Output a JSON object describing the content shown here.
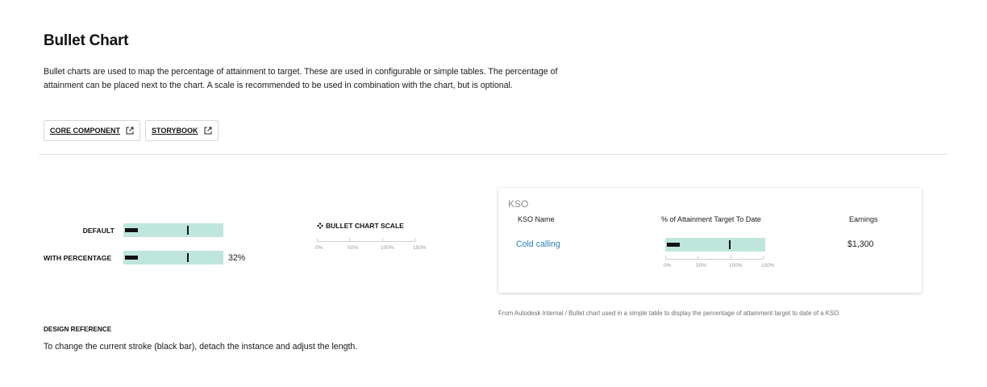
{
  "header": {
    "title": "Bullet Chart",
    "description": "Bullet charts are used to map the percentage of attainment to target. These are used in configurable or simple tables. The percentage of attainment can be placed next to the chart. A scale is recommended to be used in combination with the chart, but is optional."
  },
  "links": {
    "core_component": "CORE COMPONENT",
    "storybook": "STORYBOOK"
  },
  "demo": {
    "default_label": "DEFAULT",
    "with_percentage_label": "WITH PERCENTAGE",
    "percentage_value": "32%",
    "bar_fill_fraction": 0.13,
    "target_fraction": 0.64
  },
  "scale": {
    "title": "BULLET CHART SCALE",
    "ticks": [
      "0%",
      "50%",
      "100%",
      "150%"
    ]
  },
  "kso_card": {
    "title": "KSO",
    "columns": {
      "name": "KSO Name",
      "attainment": "% of Attainment Target To Date",
      "earnings": "Earnings"
    },
    "row": {
      "name": "Cold calling",
      "earnings": "$1,300"
    }
  },
  "caption": "From Autodesk Internal / Bullet chart used in a simple table to display the percentage of attainment target to date of a KSO.",
  "design_reference": {
    "heading": "DESIGN REFERENCE",
    "text": "To change the current stroke (black bar), detach the instance and adjust the length."
  },
  "colors": {
    "bullet_background": "#bfe6dc",
    "bar": "#111111",
    "link": "#2a7fb8"
  },
  "icons": {
    "external_link": "external-link-icon",
    "component": "component-icon"
  }
}
